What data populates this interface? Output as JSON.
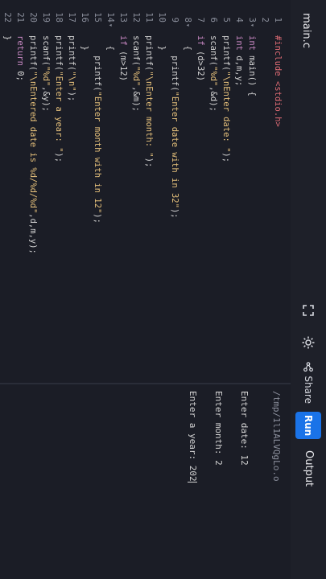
{
  "editor": {
    "tab_label": "main.c",
    "lines": [
      {
        "num": "1",
        "fold": "",
        "text": "#include <stdio.h>"
      },
      {
        "num": "2",
        "fold": "",
        "text": ""
      },
      {
        "num": "3",
        "fold": "▾",
        "text": "int main() {"
      },
      {
        "num": "4",
        "fold": "",
        "text": "int d,m,y;"
      },
      {
        "num": "5",
        "fold": "",
        "text": "printf(\"\\nEnter date: \");"
      },
      {
        "num": "6",
        "fold": "",
        "text": "scanf(\"%d\",&d);"
      },
      {
        "num": "7",
        "fold": "",
        "text": "if (d>32)"
      },
      {
        "num": "8",
        "fold": "▾",
        "text": "  {"
      },
      {
        "num": "9",
        "fold": "",
        "text": "    printf(\"Enter date with in 32\");"
      },
      {
        "num": "10",
        "fold": "",
        "text": "  }"
      },
      {
        "num": "11",
        "fold": "",
        "text": "printf(\"\\nEnter month: \");"
      },
      {
        "num": "12",
        "fold": "",
        "text": "scanf(\"%d\",&m);"
      },
      {
        "num": "13",
        "fold": "",
        "text": "if (m>12)"
      },
      {
        "num": "14",
        "fold": "▾",
        "text": "  {"
      },
      {
        "num": "15",
        "fold": "",
        "text": "    printf(\"Enter month with in 12\");"
      },
      {
        "num": "16",
        "fold": "",
        "text": "  }"
      },
      {
        "num": "17",
        "fold": "",
        "text": "printf(\"\\n\");"
      },
      {
        "num": "18",
        "fold": "",
        "text": "printf(\"Enter a year: \");"
      },
      {
        "num": "19",
        "fold": "",
        "text": "scanf(\"%d\",&y);"
      },
      {
        "num": "20",
        "fold": "",
        "text": "printf(\"\\nEntered date is %d/%d/%d\",d,m,y);"
      },
      {
        "num": "21",
        "fold": "",
        "text": "return 0;"
      },
      {
        "num": "22",
        "fold": "",
        "text": "}"
      }
    ]
  },
  "toolbar": {
    "fullscreen_icon": "fullscreen-icon",
    "theme_icon": "sun-icon",
    "share_icon": "share-icon",
    "share_label": "Share",
    "run_label": "Run"
  },
  "output": {
    "title": "Output",
    "path": "/tmp/1l1ALVQgLo.o",
    "lines": [
      "Enter date: 12",
      "",
      "Enter month: 2",
      "",
      "Enter a year: 202"
    ]
  },
  "colors": {
    "accent": "#1a73e8",
    "background": "#1b1d26",
    "keyword": "#c586c0",
    "string": "#e5c07b",
    "include": "#e06c75"
  }
}
